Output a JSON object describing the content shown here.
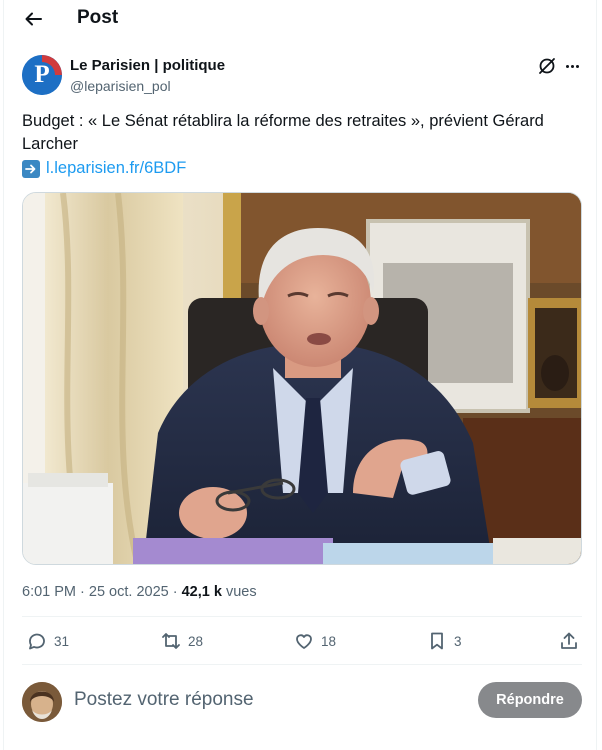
{
  "header": {
    "title": "Post"
  },
  "author": {
    "name": "Le Parisien | politique",
    "handle": "@leparisien_pol",
    "avatar_letter": "P",
    "avatar_color": "#1d6fc4"
  },
  "tweet": {
    "text": "Budget : « Le Sénat rétablira la réforme des retraites », prévient Gérard Larcher",
    "link": "l.leparisien.fr/6BDF",
    "link_icon": "right-arrow-emoji"
  },
  "meta": {
    "time": "6:01 PM · 25 oct. 2025 · ",
    "views_count": "42,1 k",
    "views_label": " vues"
  },
  "actions": {
    "replies": "31",
    "reposts": "28",
    "likes": "18",
    "bookmarks": "3"
  },
  "reply": {
    "placeholder": "Postez votre réponse",
    "button_label": "Répondre"
  },
  "colors": {
    "link": "#1d9bf0",
    "muted": "#536471",
    "button": "#87898c"
  }
}
